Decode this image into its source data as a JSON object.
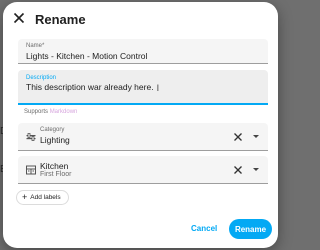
{
  "dialog": {
    "title": "Rename",
    "close_icon": "close-icon"
  },
  "name_field": {
    "label": "Name*",
    "value": "Lights - Kitchen - Motion Control"
  },
  "description_field": {
    "label": "Description",
    "value": "This description war already here."
  },
  "supports": {
    "prefix": "Supports ",
    "link": "Markdown"
  },
  "category_field": {
    "icon": "category-icon",
    "label": "Category",
    "value": "Lighting"
  },
  "area_field": {
    "icon": "area-icon",
    "name": "Kitchen",
    "floor": "First Floor"
  },
  "labels": {
    "add_label": "Add labels"
  },
  "actions": {
    "cancel": "Cancel",
    "rename": "Rename"
  },
  "colors": {
    "accent": "#03a9f4",
    "dialog_bg": "#ffffff",
    "overlay": "#6f6f6f"
  }
}
